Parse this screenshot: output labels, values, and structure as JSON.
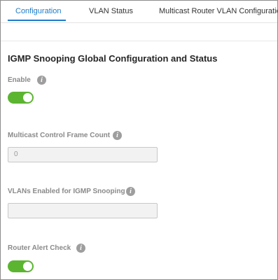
{
  "tabs": [
    {
      "label": "Configuration",
      "active": true
    },
    {
      "label": "VLAN Status",
      "active": false
    },
    {
      "label": "Multicast Router VLAN Configuration",
      "active": false
    }
  ],
  "section_title": "IGMP Snooping Global Configuration and Status",
  "fields": {
    "enable": {
      "label": "Enable",
      "value": true
    },
    "multicast_control_frame_count": {
      "label": "Multicast Control Frame Count",
      "value": "0"
    },
    "vlans_enabled": {
      "label": "VLANs Enabled for IGMP Snooping",
      "value": ""
    },
    "router_alert_check": {
      "label": "Router Alert Check",
      "value": true
    }
  },
  "icons": {
    "info": "info-icon"
  },
  "colors": {
    "accent": "#1e7cc8",
    "toggle_on": "#5cb531",
    "info_icon": "#9e9e9e"
  }
}
